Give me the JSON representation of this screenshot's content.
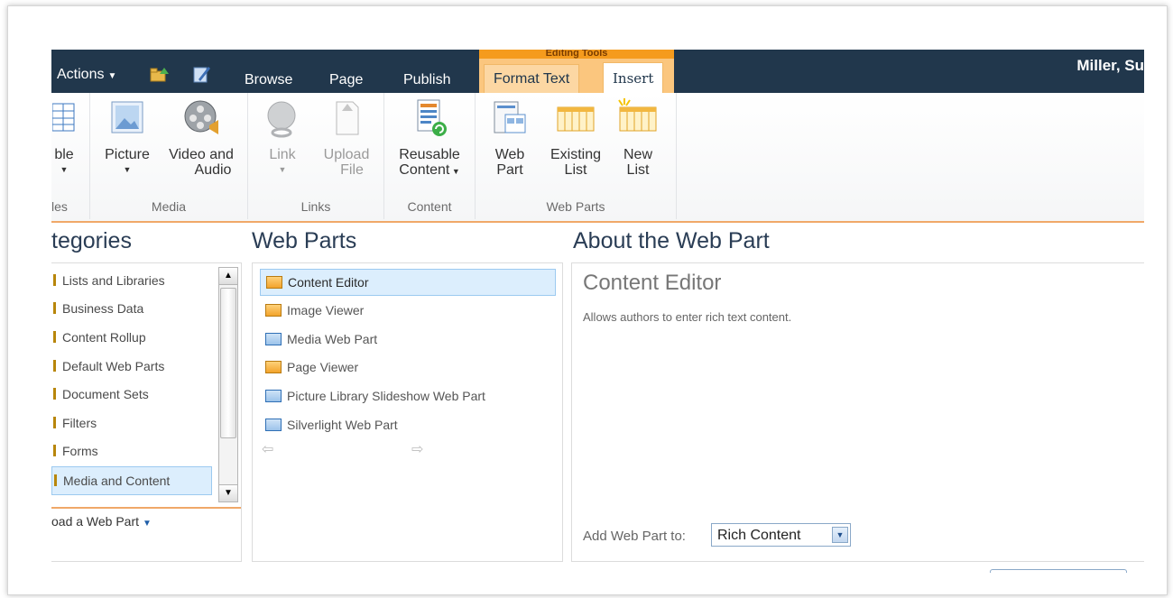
{
  "topbar": {
    "site_actions": "Actions",
    "context_group": "Editing Tools",
    "tabs": [
      "Browse",
      "Page",
      "Publish"
    ],
    "context_tabs": [
      "Format Text",
      "Insert"
    ],
    "user": "Miller, Su"
  },
  "ribbon": {
    "tables_group": {
      "button": "ble",
      "label": "les"
    },
    "media": {
      "label": "Media",
      "picture": "Picture",
      "video_line1": "Video and",
      "video_line2": "Audio"
    },
    "links": {
      "label": "Links",
      "link": "Link",
      "upload_line1": "Upload",
      "upload_line2": "File"
    },
    "content": {
      "label": "Content",
      "reusable_line1": "Reusable",
      "reusable_line2": "Content"
    },
    "webparts": {
      "label": "Web Parts",
      "web_line1": "Web",
      "web_line2": "Part",
      "existing_line1": "Existing",
      "existing_line2": "List",
      "new_line1": "New",
      "new_line2": "List"
    }
  },
  "categories": {
    "title": "tegories",
    "items": [
      "Lists and Libraries",
      "Business Data",
      "Content Rollup",
      "Default Web Parts",
      "Document Sets",
      "Filters",
      "Forms",
      "Media and Content"
    ],
    "selected": "Media and Content",
    "upload": "oad a Web Part"
  },
  "webparts": {
    "title": "Web Parts",
    "items": [
      "Content Editor",
      "Image Viewer",
      "Media Web Part",
      "Page Viewer",
      "Picture Library Slideshow Web Part",
      "Silverlight Web Part"
    ],
    "selected": "Content Editor"
  },
  "about": {
    "title": "About the Web Part",
    "part_name": "Content Editor",
    "description": "Allows authors to enter rich text content.",
    "add_to_label": "Add Web Part to:",
    "add_to_value": "Rich Content"
  },
  "colors": {
    "topbar": "#21374c",
    "accent": "#f59b1d",
    "selection": "#dceefd"
  }
}
